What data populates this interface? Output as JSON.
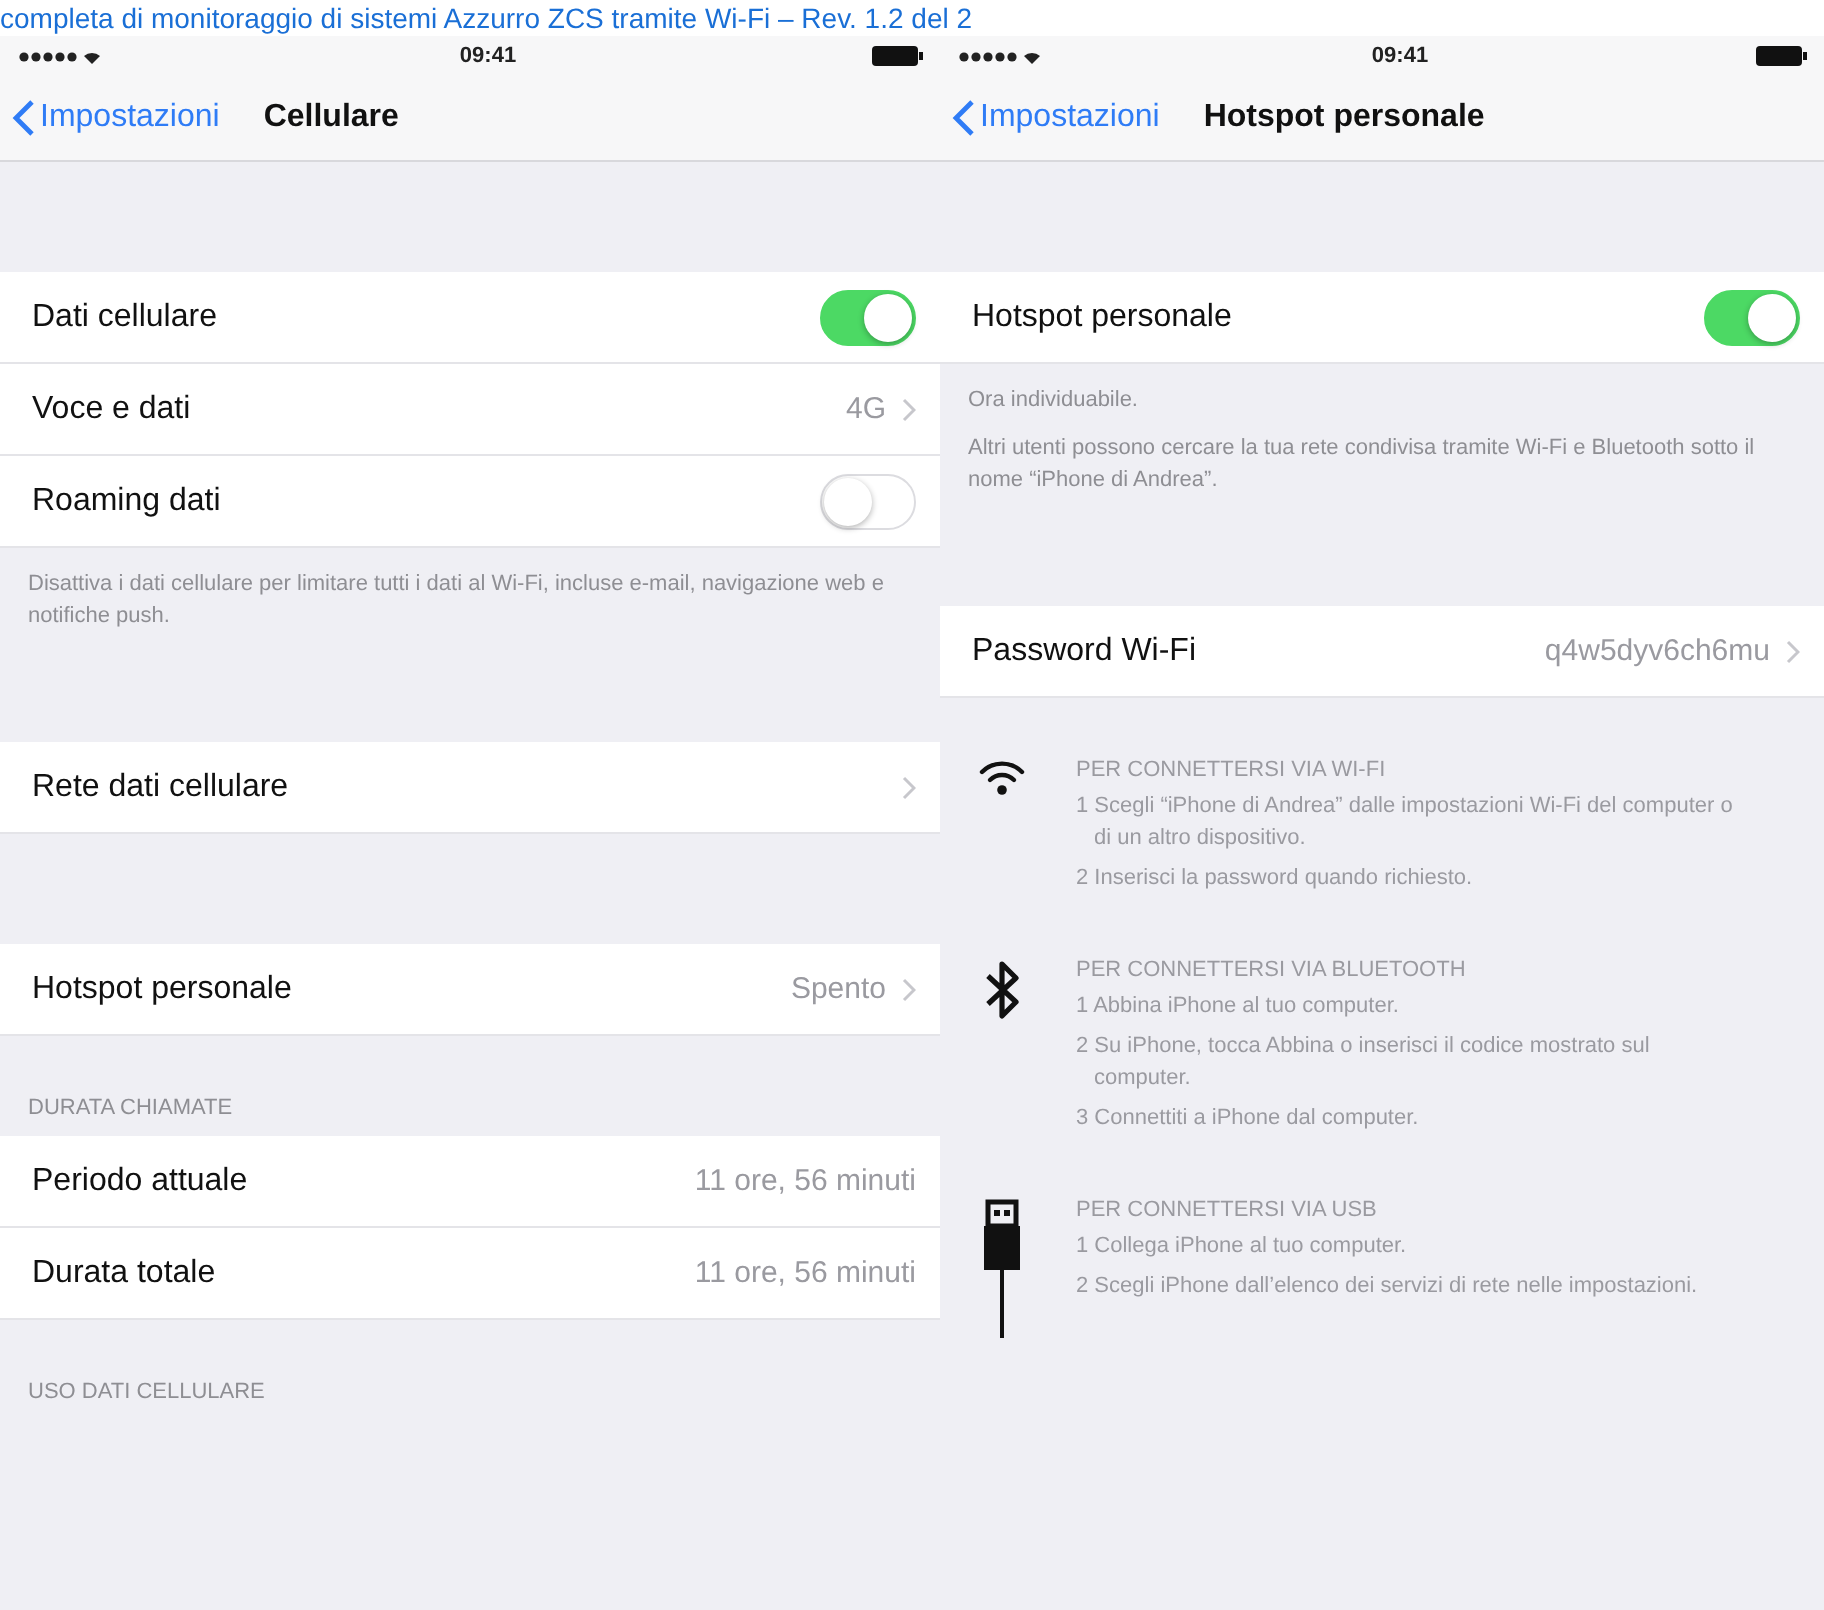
{
  "banner": "completa di monitoraggio di sistemi Azzurro ZCS tramite Wi-Fi – Rev. 1.2 del 2",
  "screens": [
    {
      "status": {
        "time": "09:41"
      },
      "nav": {
        "back": "Impostazioni",
        "title": "Cellulare"
      },
      "sections": [
        {
          "kind": "group",
          "rows": [
            {
              "kind": "toggle",
              "label": "Dati cellulare",
              "on": true
            },
            {
              "kind": "detail",
              "label": "Voce e dati",
              "value": "4G"
            },
            {
              "kind": "toggle",
              "label": "Roaming dati",
              "on": false
            }
          ],
          "footer": [
            "Disattiva i dati cellulare per limitare tutti i dati al Wi-Fi, incluse e-mail, navigazione web e notifiche push."
          ]
        },
        {
          "kind": "group",
          "rows": [
            {
              "kind": "detail",
              "label": "Rete dati cellulare"
            }
          ]
        },
        {
          "kind": "group",
          "rows": [
            {
              "kind": "detail",
              "label": "Hotspot personale",
              "value": "Spento"
            }
          ]
        },
        {
          "kind": "group",
          "header": "DURATA CHIAMATE",
          "rows": [
            {
              "kind": "info",
              "label": "Periodo attuale",
              "value": "11 ore, 56 minuti"
            },
            {
              "kind": "info",
              "label": "Durata totale",
              "value": "11 ore, 56 minuti"
            }
          ]
        },
        {
          "kind": "group",
          "header": "USO DATI CELLULARE"
        }
      ]
    },
    {
      "status": {
        "time": "09:41"
      },
      "nav": {
        "back": "Impostazioni",
        "title": "Hotspot personale"
      },
      "sections": [
        {
          "kind": "group",
          "rows": [
            {
              "kind": "toggle",
              "label": "Hotspot personale",
              "on": true
            }
          ],
          "footer": [
            "Ora individuabile.",
            "Altri utenti possono cercare la tua rete condivisa tramite Wi-Fi e Bluetooth sotto il nome “iPhone di Andrea”."
          ]
        },
        {
          "kind": "group",
          "rows": [
            {
              "kind": "detail",
              "label": "Password Wi-Fi",
              "value": "q4w5dyv6ch6mu"
            }
          ]
        },
        {
          "kind": "instructions",
          "items": [
            {
              "kind": "wifi",
              "title": "PER CONNETTERSI VIA WI-FI",
              "steps": [
                "1 Scegli “iPhone di Andrea” dalle impostazioni Wi-Fi del computer o di un altro dispositivo.",
                "2 Inserisci la password quando richiesto."
              ]
            },
            {
              "kind": "bluetooth",
              "title": "PER CONNETTERSI VIA BLUETOOTH",
              "steps": [
                "1 Abbina iPhone al tuo computer.",
                "2 Su iPhone, tocca Abbina o inserisci il codice mostrato sul computer.",
                "3 Connettiti a iPhone dal computer."
              ]
            },
            {
              "kind": "usb",
              "title": "PER CONNETTERSI VIA USB",
              "steps": [
                "1 Collega iPhone al tuo computer.",
                "2 Scegli iPhone dall’elenco dei servizi di rete nelle impostazioni."
              ]
            }
          ]
        }
      ]
    }
  ]
}
